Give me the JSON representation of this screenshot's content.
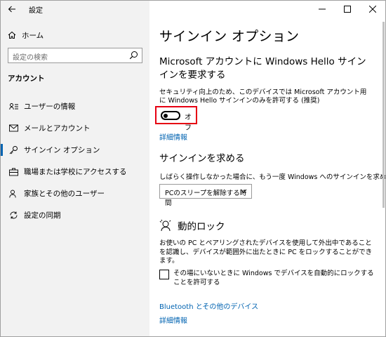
{
  "window": {
    "title": "設定"
  },
  "sidebar": {
    "home_label": "ホーム",
    "search_placeholder": "設定の検索",
    "section_title": "アカウント",
    "items": [
      {
        "label": "ユーザーの情報",
        "icon": "user-info-icon"
      },
      {
        "label": "メールとアカウント",
        "icon": "mail-icon"
      },
      {
        "label": "サインイン オプション",
        "icon": "key-icon",
        "active": true
      },
      {
        "label": "職場または学校にアクセスする",
        "icon": "briefcase-icon"
      },
      {
        "label": "家族とその他のユーザー",
        "icon": "person-add-icon"
      },
      {
        "label": "設定の同期",
        "icon": "sync-icon"
      }
    ]
  },
  "main": {
    "title": "サインイン オプション",
    "hello": {
      "heading": "Microsoft アカウントに Windows Hello サインインを要求する",
      "description": "セキュリティ向上のため、このデバイスでは Microsoft アカウント用に Windows Hello サインインのみを許可する (推奨)",
      "toggle_label": "オフ",
      "toggle_on": false,
      "details_link": "詳細情報"
    },
    "require_signin": {
      "heading": "サインインを求める",
      "description": "しばらく操作しなかった場合に、もう一度 Windows へのサインインを求めるタイミング",
      "dropdown_value": "PCのスリープを解除する時間"
    },
    "dynamic_lock": {
      "heading": "動的ロック",
      "description": "お使いの PC とペアリングされたデバイスを使用して外出中であることを認識し、デバイスが範囲外に出たときに PC をロックすることができます。",
      "checkbox_label": "その場にいないときに Windows でデバイスを自動的にロックすることを許可する",
      "checkbox_checked": false,
      "bluetooth_link": "Bluetooth とその他のデバイス",
      "details_link": "詳細情報"
    }
  },
  "colors": {
    "accent": "#0063b1",
    "highlight_border": "#e60012",
    "sidebar_bg": "#f2f2f2"
  }
}
